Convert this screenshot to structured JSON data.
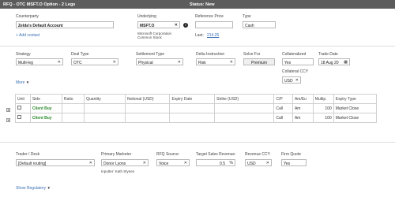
{
  "window": {
    "title": "RFQ - OTC MSFT.O Option - 2 Legs",
    "status": "Status: New"
  },
  "counterparty": {
    "label": "Counterparty",
    "value": "Zelda's Default Account",
    "add_contact": "+ Add contact"
  },
  "underlying": {
    "label": "Underlying",
    "value": "MSFT.O",
    "description_line1": "Microsoft Corporation",
    "description_line2": "Common Stock"
  },
  "reference_price": {
    "label": "Reference Price",
    "value": "",
    "last_label": "Last:",
    "last_value": "214.25"
  },
  "type": {
    "label": "Type",
    "value": "Cash"
  },
  "strategy": {
    "label": "Strategy",
    "value": "Multi-leg"
  },
  "deal_type": {
    "label": "Deal Type",
    "value": "OTC"
  },
  "settlement_type": {
    "label": "Settlement Type",
    "value": "Physical"
  },
  "delta_instruction": {
    "label": "Delta Instruction",
    "value": "Risk"
  },
  "solve_for": {
    "label": "Solve For",
    "value": "Premium"
  },
  "collateralized": {
    "label": "Collateralized",
    "value": "Yes"
  },
  "trade_date": {
    "label": "Trade Date",
    "value": "18 Aug 20"
  },
  "collateral_ccy": {
    "label": "Collateral CCY",
    "value": "USD"
  },
  "more": {
    "label": "More"
  },
  "legs": {
    "headers": [
      "Unit",
      "Side",
      "Ratio",
      "Quantity",
      "Notional (USD)",
      "Expiry Date",
      "Strike (USD)",
      "C/P",
      "Am/Eu",
      "Multip.",
      "Expiry Type"
    ],
    "rows": [
      {
        "unit": "",
        "side": "Client Buy",
        "ratio": "",
        "quantity": "",
        "notional": "",
        "expiry_date": "",
        "strike": "",
        "cp": "Call",
        "ameu": "Am",
        "multip": "100",
        "expiry_type": "Market Close"
      },
      {
        "unit": "",
        "side": "Client Buy",
        "ratio": "",
        "quantity": "",
        "notional": "",
        "expiry_date": "",
        "strike": "",
        "cp": "Call",
        "ameu": "Am",
        "multip": "100",
        "expiry_type": "Market Close"
      }
    ]
  },
  "trader_desk": {
    "label": "Trader / Desk",
    "value": "[Default routing]"
  },
  "primary_marketer": {
    "label": "Primary Marketer",
    "value": "Donor Lyons",
    "inputter": "Inputter: Kath Stynes"
  },
  "rfq_source": {
    "label": "RFQ Source:",
    "value": "Voice"
  },
  "target_sales_revenue": {
    "label": "Target Sales Revenue:",
    "value": "0.5",
    "unit": "%"
  },
  "revenue_ccy": {
    "label": "Revenue CCY",
    "value": "USD"
  },
  "firm_quote": {
    "label": "Firm Quote",
    "value": "Yes"
  },
  "show_regulatory": {
    "label": "Show Regulatory"
  },
  "icons": {
    "clear": "✕",
    "caret": "▼",
    "info": "i",
    "calendar": "▦"
  }
}
